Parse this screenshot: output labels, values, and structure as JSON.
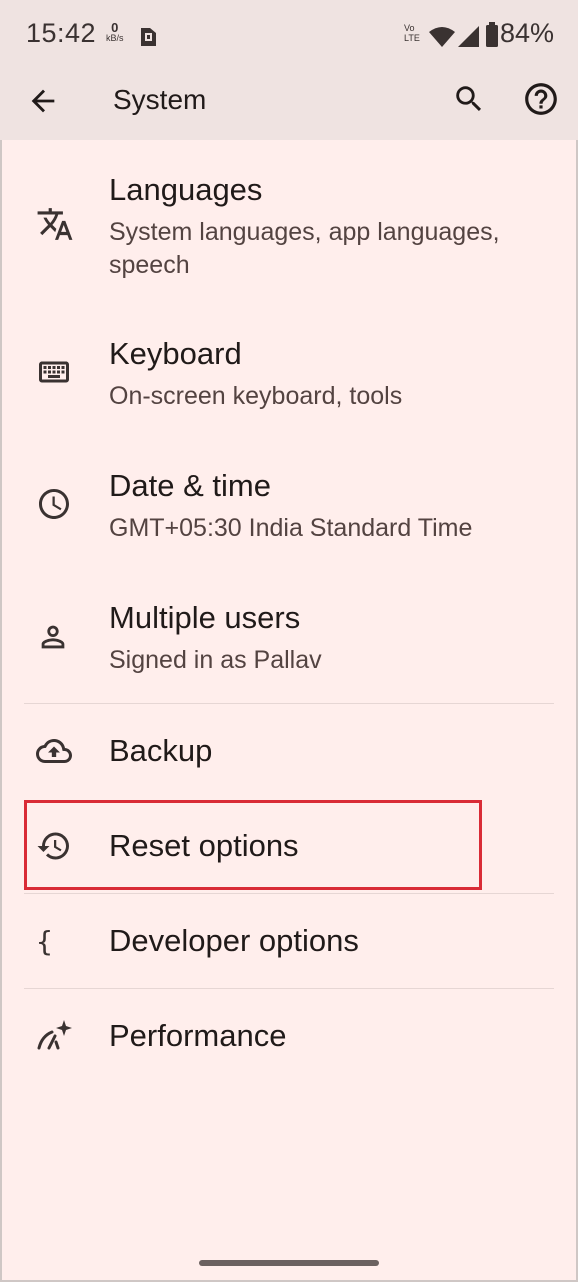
{
  "status_bar": {
    "time": "15:42",
    "net_speed_value": "0",
    "net_speed_unit": "kB/s",
    "volte_top": "Vo",
    "volte_bottom": "LTE",
    "battery": "84%"
  },
  "app_bar": {
    "title": "System"
  },
  "items": [
    {
      "label": "Languages",
      "sub": "System languages, app languages, speech",
      "icon": "translate-icon"
    },
    {
      "label": "Keyboard",
      "sub": "On-screen keyboard, tools",
      "icon": "keyboard-icon"
    },
    {
      "label": "Date & time",
      "sub": "GMT+05:30 India Standard Time",
      "icon": "clock-icon"
    },
    {
      "label": "Multiple users",
      "sub": "Signed in as Pallav",
      "icon": "person-icon"
    },
    {
      "label": "Backup",
      "icon": "cloud-upload-icon"
    },
    {
      "label": "Reset options",
      "icon": "history-icon"
    },
    {
      "label": "Developer options",
      "icon": "braces-icon"
    },
    {
      "label": "Performance",
      "icon": "performance-icon"
    }
  ],
  "colors": {
    "background": "#ffeeec",
    "bar_background": "#efe3e1",
    "highlight": "#d92b36"
  }
}
